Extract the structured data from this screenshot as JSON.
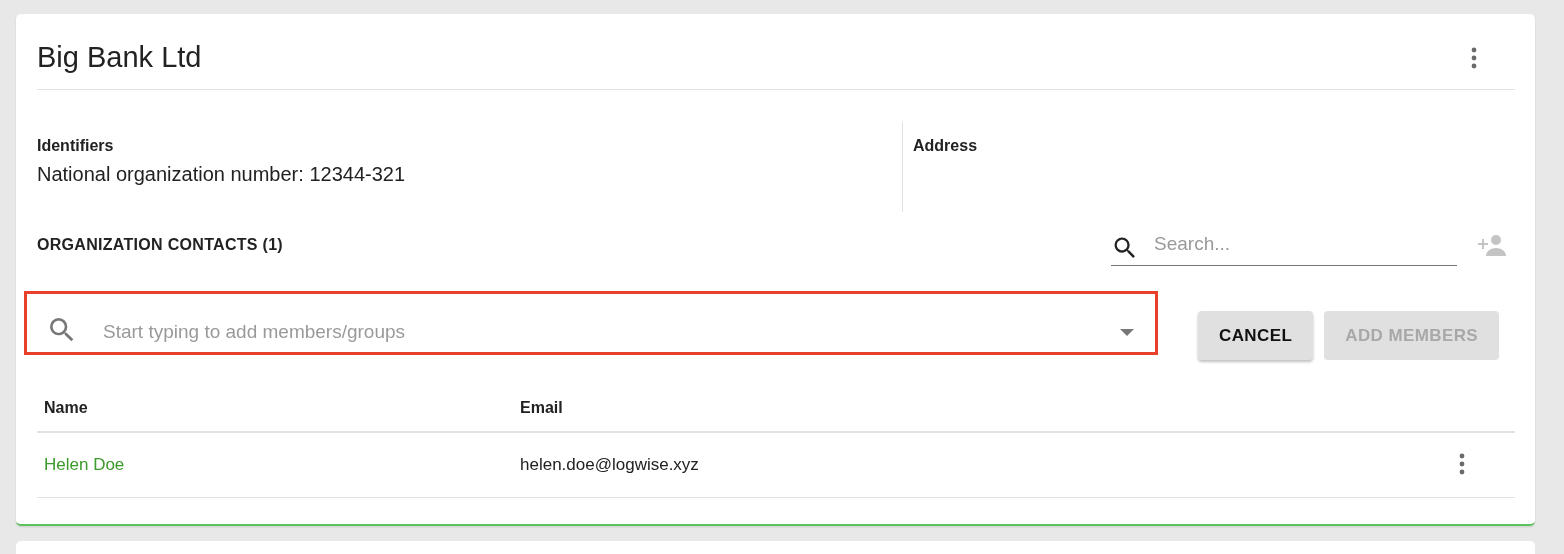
{
  "card": {
    "title": "Big Bank Ltd",
    "identifiers": {
      "heading": "Identifiers",
      "lines": [
        "National organization number: 12344-321"
      ]
    },
    "address": {
      "heading": "Address"
    },
    "contacts": {
      "heading": "ORGANIZATION CONTACTS (1)",
      "search": {
        "placeholder": "Search..."
      },
      "member_picker": {
        "placeholder": "Start typing to add members/groups",
        "highlighted": true
      },
      "buttons": [
        {
          "label": "CANCEL",
          "disabled": false
        },
        {
          "label": "ADD MEMBERS",
          "disabled": true
        }
      ],
      "table": {
        "columns": [
          "Name",
          "Email"
        ],
        "rows": [
          {
            "name": "Helen Doe",
            "email": "helen.doe@logwise.xyz"
          }
        ]
      }
    }
  }
}
